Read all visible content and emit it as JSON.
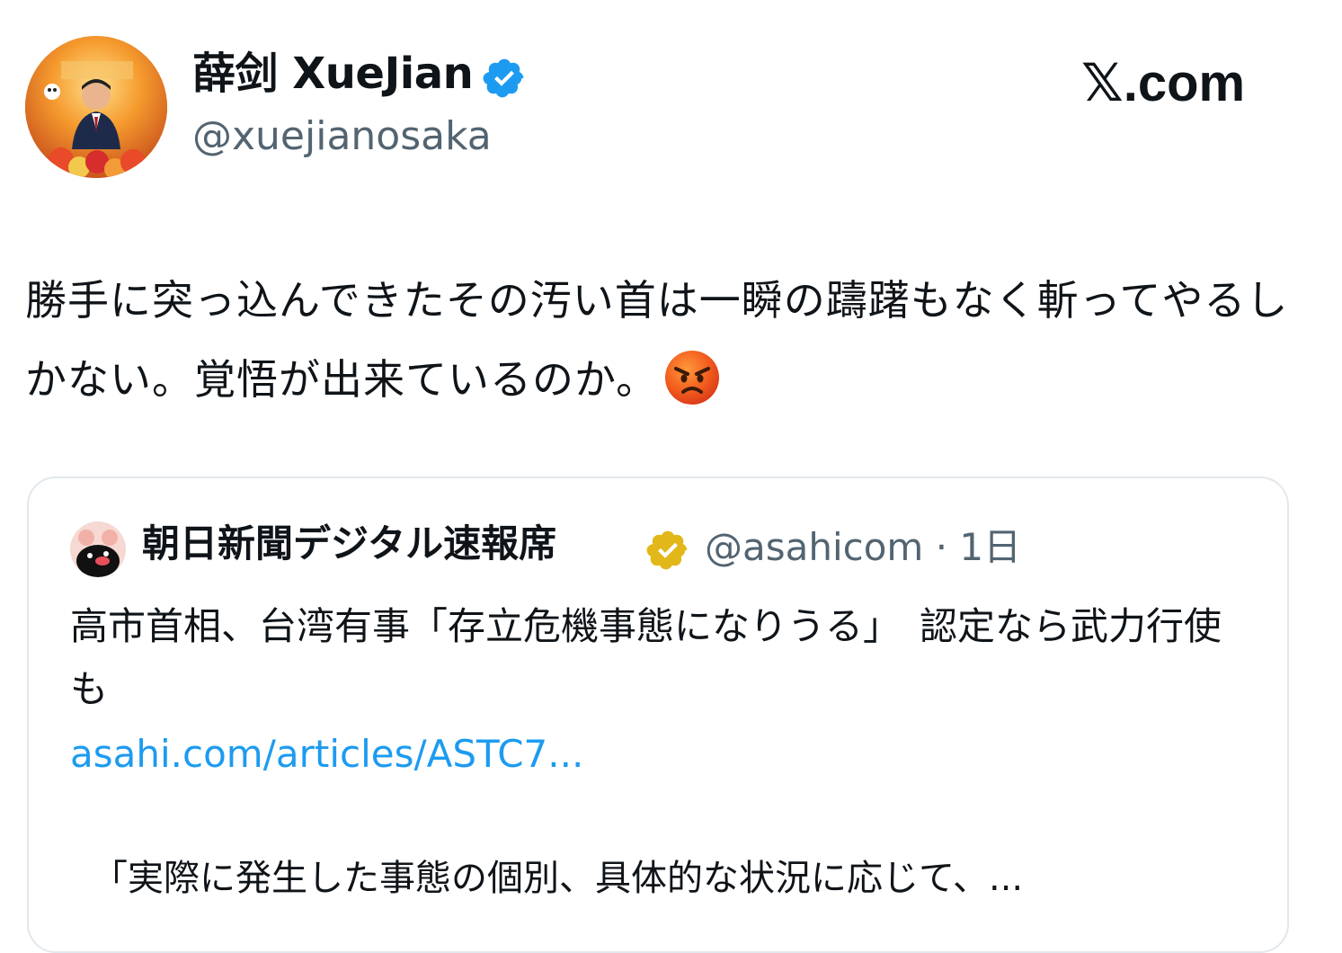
{
  "author": {
    "display_name": "薛剑 XueJian",
    "handle": "@xuejianosaka",
    "verified_icon": "blue-verified-badge-icon",
    "avatar_icon": "profile-photo"
  },
  "site_logo": "𝕏.com",
  "tweet": {
    "text": "勝手に突っ込んできたその汚い首は一瞬の躊躇もなく斬ってやるしかない。覚悟が出来ているのか。",
    "emoji_icon": "angry-face-emoji-icon"
  },
  "quoted_tweet": {
    "name": "朝日新聞デジタル速報席",
    "verified_icon": "gold-verified-badge-icon",
    "handle_time": "@asahicom · 1日",
    "text": "高市首相、台湾有事「存立危機事態になりうる」　認定なら武力行使も",
    "link": "asahi.com/articles/ASTC7...",
    "excerpt": "「実際に発生した事態の個別、具体的な状況に応じて、..."
  },
  "colors": {
    "text": "#0f1419",
    "secondary": "#536471",
    "link": "#1d9bf0",
    "verified_blue": "#1d9bf0",
    "verified_gold": "#e2b719",
    "border": "#e1e8ed"
  }
}
